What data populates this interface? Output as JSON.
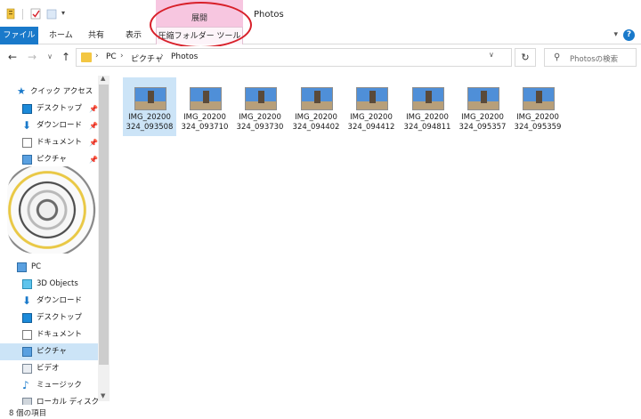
{
  "titlebar": {
    "context_tab": "展開",
    "window_title": "Photos",
    "dropdown_glyph": "▾"
  },
  "ribbon": {
    "file": "ファイル",
    "home": "ホーム",
    "share": "共有",
    "view": "表示",
    "compressed_tools": "圧縮フォルダー ツール",
    "collapse_glyph": "▾",
    "help_glyph": "?"
  },
  "nav": {
    "back_glyph": "←",
    "forward_glyph": "→",
    "recent_glyph": "∨",
    "up_glyph": "↑"
  },
  "address": {
    "sep": "›",
    "pc": "PC",
    "pictures": "ピクチャ",
    "photos": "Photos",
    "dropdown_glyph": "∨",
    "refresh_glyph": "↻"
  },
  "search": {
    "icon_glyph": "⚲",
    "placeholder": "Photosの検索"
  },
  "sidebar": {
    "quick_access": "クイック アクセス",
    "items": [
      {
        "label": "デスクトップ",
        "pinned": true
      },
      {
        "label": "ダウンロード",
        "pinned": true
      },
      {
        "label": "ドキュメント",
        "pinned": true
      },
      {
        "label": "ピクチャ",
        "pinned": true
      }
    ],
    "pin_glyph": "📌",
    "pc": "PC",
    "pc_items": [
      {
        "label": "3D Objects"
      },
      {
        "label": "ダウンロード"
      },
      {
        "label": "デスクトップ"
      },
      {
        "label": "ドキュメント"
      },
      {
        "label": "ピクチャ"
      },
      {
        "label": "ビデオ"
      },
      {
        "label": "ミュージック"
      },
      {
        "label": "ローカル ディスク (C"
      }
    ],
    "scroll_up_glyph": "▲",
    "scroll_down_glyph": "▼"
  },
  "files": [
    {
      "line1": "IMG_20200",
      "line2": "324_093508"
    },
    {
      "line1": "IMG_20200",
      "line2": "324_093710"
    },
    {
      "line1": "IMG_20200",
      "line2": "324_093730"
    },
    {
      "line1": "IMG_20200",
      "line2": "324_094402"
    },
    {
      "line1": "IMG_20200",
      "line2": "324_094412"
    },
    {
      "line1": "IMG_20200",
      "line2": "324_094811"
    },
    {
      "line1": "IMG_20200",
      "line2": "324_095357"
    },
    {
      "line1": "IMG_20200",
      "line2": "324_095359"
    }
  ],
  "status": {
    "count": "8 個の項目"
  }
}
